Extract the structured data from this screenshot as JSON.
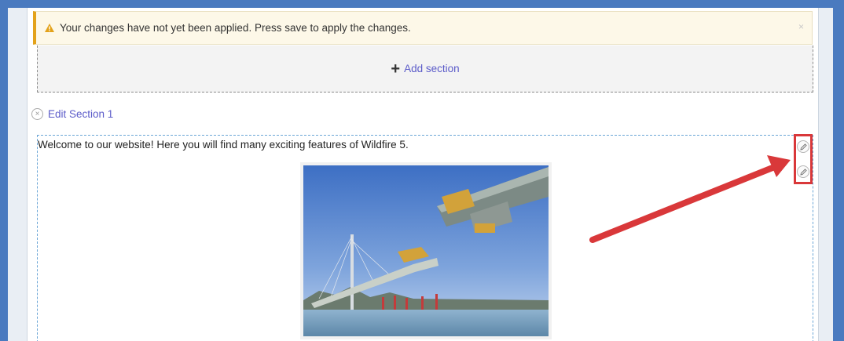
{
  "banner": {
    "message": "Your changes have not yet been applied. Press save to apply the changes.",
    "close_glyph": "×",
    "accent_color": "#e3a21a"
  },
  "add_section": {
    "plus": "+",
    "label": "Add section"
  },
  "section": {
    "edit_label": "Edit Section 1",
    "remove_glyph": "×",
    "welcome_text": "Welcome to our website! Here you will find many exciting features of Wildfire 5."
  },
  "icons": {
    "warning": "warning-icon",
    "pencil": "pencil-icon",
    "remove": "close-circle-icon"
  },
  "annotation": {
    "highlight_color": "#d9383a"
  }
}
